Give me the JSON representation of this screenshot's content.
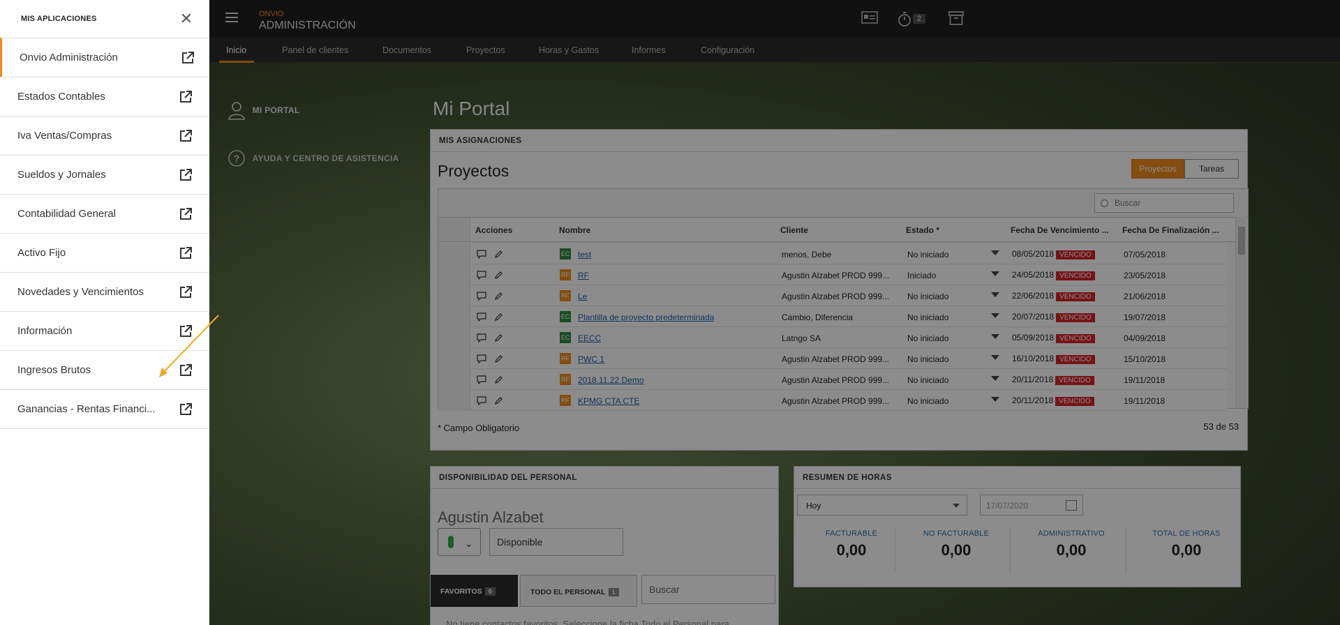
{
  "sidebar": {
    "title": "MIS APLICACIONES",
    "items": [
      {
        "label": "Onvio Administración"
      },
      {
        "label": "Estados Contables"
      },
      {
        "label": "Iva Ventas/Compras"
      },
      {
        "label": "Sueldos y Jornales"
      },
      {
        "label": "Contabilidad General"
      },
      {
        "label": "Activo Fijo"
      },
      {
        "label": "Novedades y Vencimientos"
      },
      {
        "label": "Información"
      },
      {
        "label": "Ingresos Brutos"
      },
      {
        "label": "Ganancias - Rentas Financi..."
      }
    ]
  },
  "header": {
    "brand_small": "ONVIO",
    "brand_big": "ADMINISTRACIÓN",
    "timer_count": "2",
    "icons": [
      "contact-card-icon",
      "stopwatch-icon",
      "archive-box-icon"
    ]
  },
  "nav": {
    "tabs": [
      "Inicio",
      "Panel de clientes",
      "Documentos",
      "Proyectos",
      "Horas y Gastos",
      "Informes",
      "Configuración"
    ],
    "active": "Inicio"
  },
  "left_nav": {
    "portal": "MI PORTAL",
    "help": "AYUDA Y CENTRO DE ASISTENCIA"
  },
  "main": {
    "title": "Mi Portal",
    "assignments": {
      "header": "MIS ASIGNACIONES",
      "title": "Proyectos",
      "toggle": [
        "Proyectos",
        "Tareas"
      ],
      "search_placeholder": "Buscar",
      "columns": [
        "Acciones",
        "Nombre",
        "Cliente",
        "Estado *",
        "Fecha De Vencimiento ...",
        "Fecha De Finalización ..."
      ],
      "rows": [
        {
          "type": "EC",
          "name": "test",
          "client": "menos, Debe",
          "status": "No iniciado",
          "due": "08/05/2018",
          "tag": "VENCIDO",
          "end": "07/05/2018"
        },
        {
          "type": "RF",
          "name": "RF",
          "client": "Agustin Alzabet PROD 999...",
          "status": "Iniciado",
          "due": "24/05/2018",
          "tag": "VENCIDO",
          "end": "23/05/2018"
        },
        {
          "type": "RF",
          "name": "Le",
          "client": "Agustin Alzabet PROD 999...",
          "status": "No iniciado",
          "due": "22/06/2018",
          "tag": "VENCIDO",
          "end": "21/06/2018"
        },
        {
          "type": "EC",
          "name": "Plantilla de proyecto predeterminada",
          "client": "Cambio, Diferencia",
          "status": "No iniciado",
          "due": "20/07/2018",
          "tag": "VENCIDO",
          "end": "19/07/2018"
        },
        {
          "type": "EC",
          "name": "EECC",
          "client": "Latngo SA",
          "status": "No iniciado",
          "due": "05/09/2018",
          "tag": "VENCIDO",
          "end": "04/09/2018"
        },
        {
          "type": "RF",
          "name": "PWC 1",
          "client": "Agustin Alzabet PROD 999...",
          "status": "No iniciado",
          "due": "16/10/2018",
          "tag": "VENCIDO",
          "end": "15/10/2018"
        },
        {
          "type": "RF",
          "name": "2018.11.22 Demo",
          "client": "Agustin Alzabet PROD 999...",
          "status": "No iniciado",
          "due": "20/11/2018",
          "tag": "VENCIDO",
          "end": "19/11/2018"
        },
        {
          "type": "RF",
          "name": "KPMG CTA CTE",
          "client": "Agustin Alzabet PROD 999...",
          "status": "No iniciado",
          "due": "20/11/2018",
          "tag": "VENCIDO",
          "end": "19/11/2018"
        }
      ],
      "footnote": "* Campo Obligatorio",
      "count": "53 de 53"
    },
    "availability": {
      "header": "DISPONIBILIDAD DEL PERSONAL",
      "agent": "Agustin Alzabet",
      "status": "Disponible",
      "tabs": [
        {
          "label": "FAVORITOS",
          "count": "0"
        },
        {
          "label": "TODO EL PERSONAL",
          "count": "1"
        }
      ],
      "search_placeholder": "Buscar",
      "note": "No tiene contactos favoritos. Seleccione la ficha Todo el Personal para..."
    },
    "hours": {
      "header": "RESUMEN DE HORAS",
      "period": "Hoy",
      "date": "17/07/2020",
      "cols": [
        {
          "label": "FACTURABLE",
          "value": "0,00"
        },
        {
          "label": "NO FACTURABLE",
          "value": "0,00"
        },
        {
          "label": "ADMINISTRATIVO",
          "value": "0,00"
        },
        {
          "label": "TOTAL DE HORAS",
          "value": "0,00"
        }
      ]
    }
  },
  "colors": {
    "accent": "#f08c1c",
    "overdue": "#d6232b",
    "ec_badge": "#2e8b3e",
    "rf_badge": "#f08c1c",
    "arrow": "#f5a623"
  }
}
